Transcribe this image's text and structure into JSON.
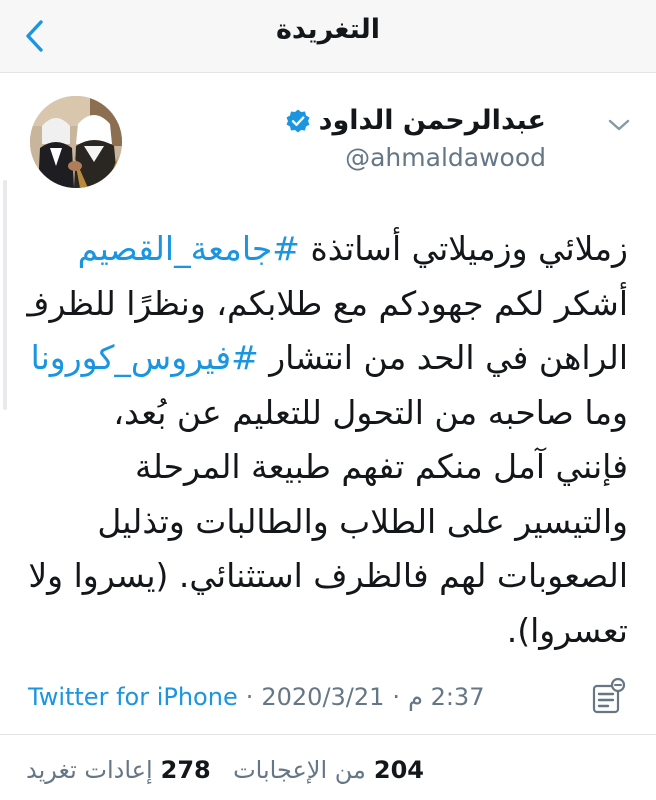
{
  "header": {
    "title": "التغريدة",
    "back_icon": "chevron-left-icon"
  },
  "tweet": {
    "author_name": "عبدالرحمن الداود",
    "author_handle": "@ahmaldawood",
    "verified": true,
    "lines": [
      {
        "parts": [
          {
            "text": "زملائي وزميلاتي أساتذة ",
            "tag": false
          },
          {
            "text": "#جامعة_القصيم",
            "tag": true
          }
        ]
      },
      {
        "parts": [
          {
            "text": "أشكر لكم جهودكم مع طلابكم، ونظرًا للظرف",
            "tag": false
          }
        ]
      },
      {
        "parts": [
          {
            "text": "الراهن في الحد من انتشار ",
            "tag": false
          },
          {
            "text": "#فيروس_كورونا",
            "tag": true
          }
        ]
      },
      {
        "parts": [
          {
            "text": "وما صاحبه من التحول للتعليم عن بُعد،",
            "tag": false
          }
        ]
      },
      {
        "parts": [
          {
            "text": "فإنني آمل منكم تفهم طبيعة المرحلة",
            "tag": false
          }
        ]
      },
      {
        "parts": [
          {
            "text": "والتيسير على الطلاب والطالبات وتذليل",
            "tag": false
          }
        ]
      },
      {
        "parts": [
          {
            "text": "الصعوبات لهم فالظرف استثنائي. (يسروا ولا",
            "tag": false
          }
        ]
      },
      {
        "parts": [
          {
            "text": "تعسروا).",
            "tag": false
          }
        ]
      }
    ],
    "meta": {
      "source": "Twitter for iPhone",
      "date": "2020/3/21",
      "time": "2:37 م"
    },
    "stats": {
      "likes_count": "204",
      "likes_label": "من الإعجابات",
      "retweets_count": "278",
      "retweets_label": "إعادات تغريد"
    }
  },
  "colors": {
    "accent": "#1b95e0",
    "text": "#14171a",
    "muted": "#657786",
    "header_bg": "#f7f7f8"
  }
}
